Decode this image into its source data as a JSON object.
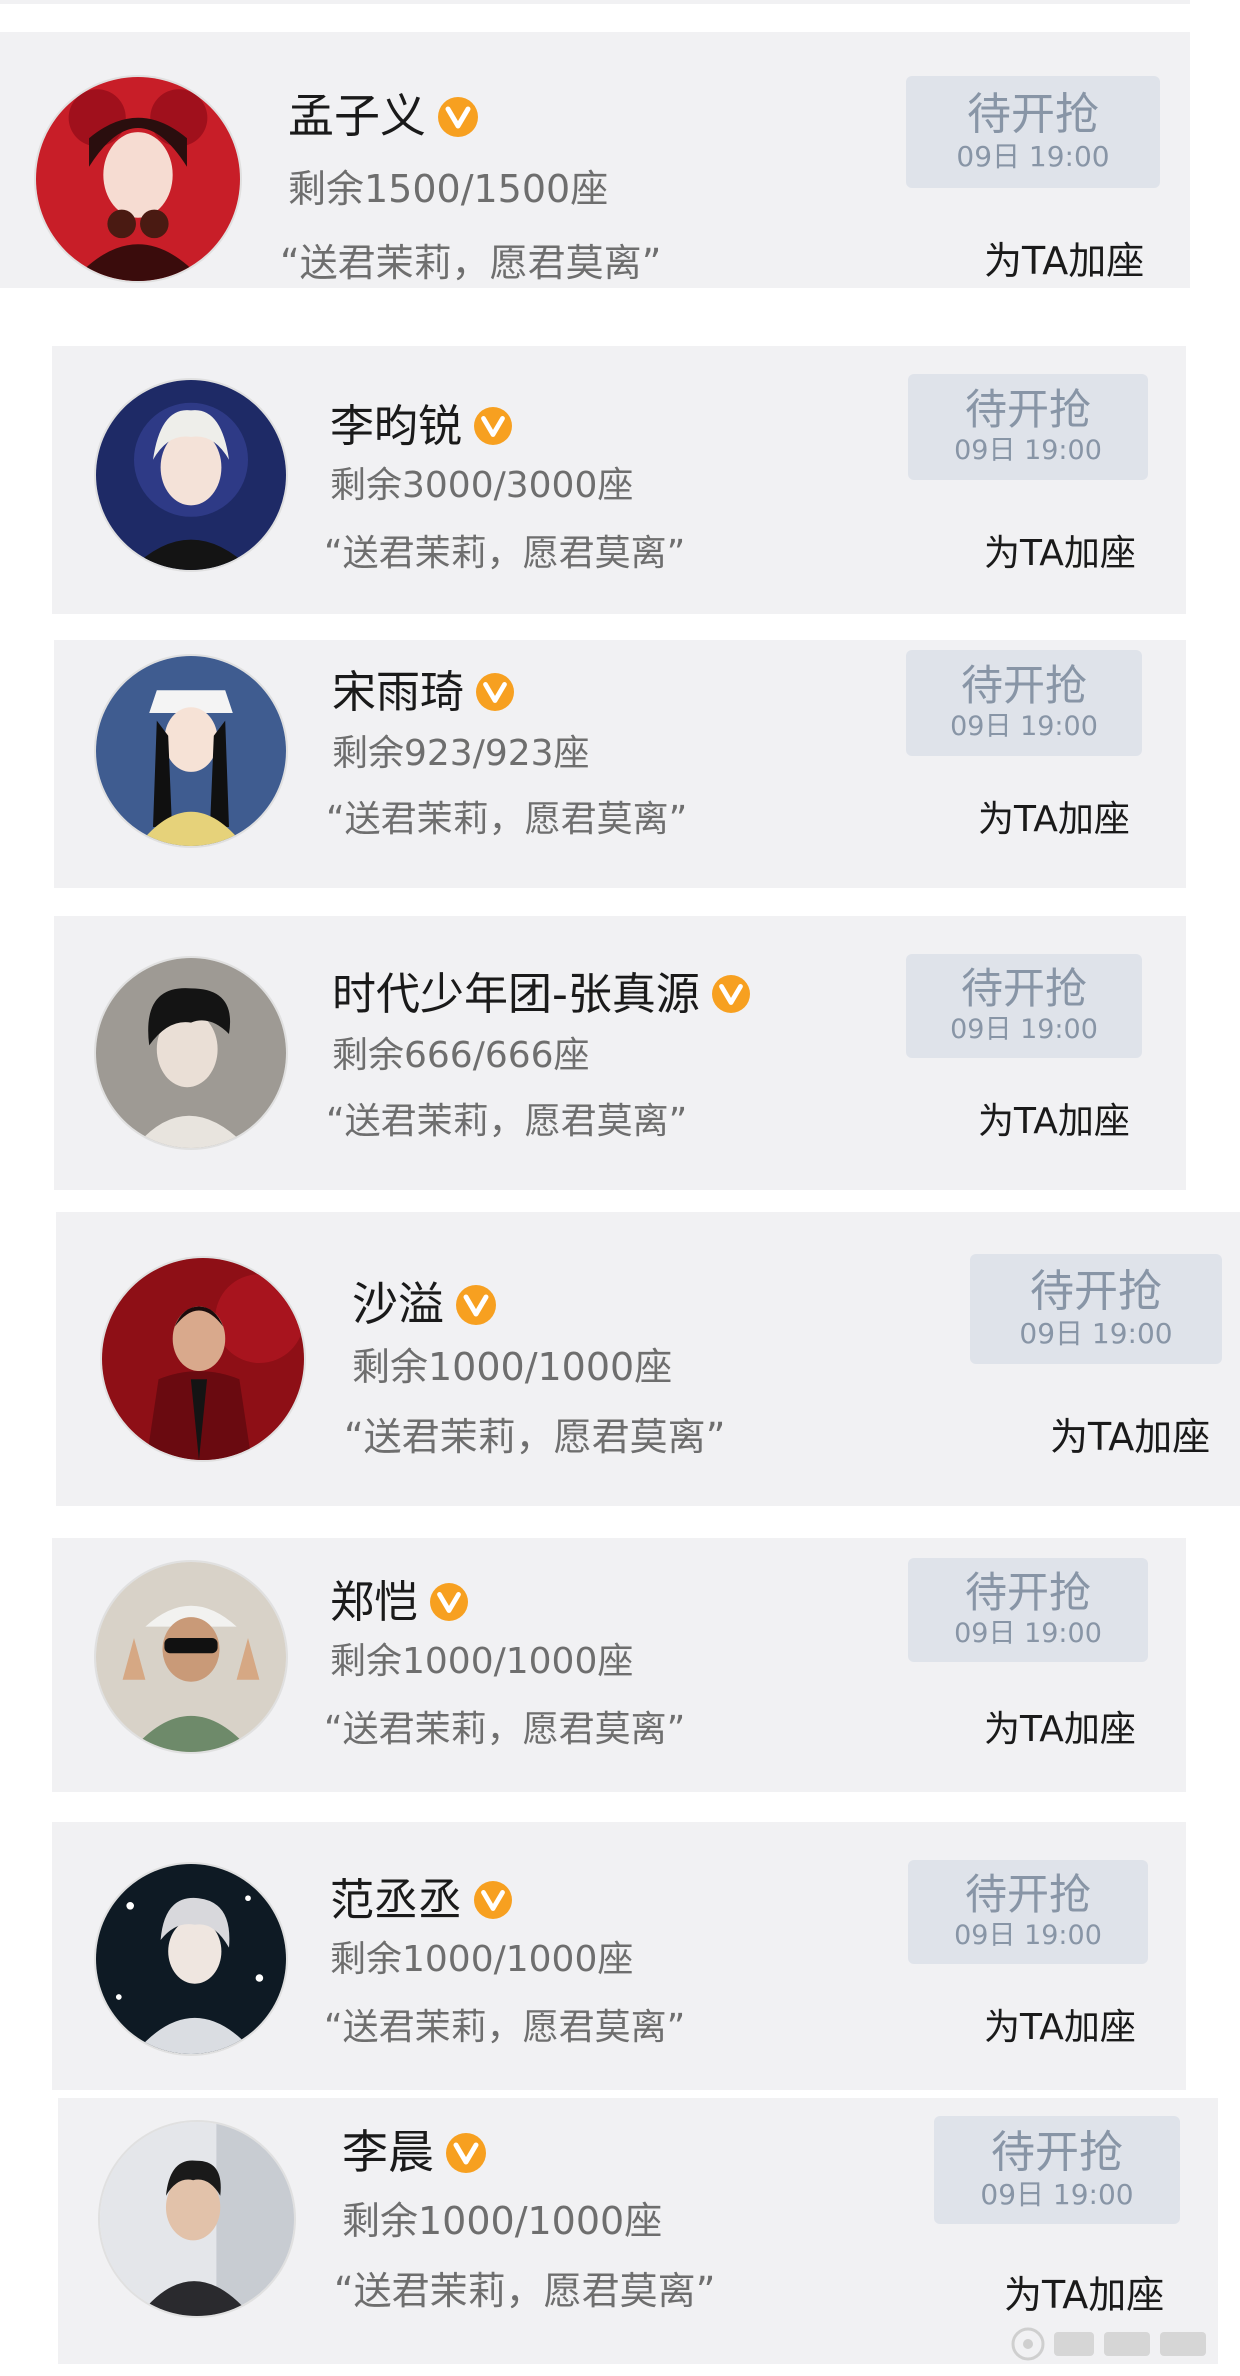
{
  "colors": {
    "card_bg": "#f1f1f3",
    "badge": "#f7a020",
    "button_bg": "#dfe3ea",
    "button_text": "#8895a6"
  },
  "cards": [
    {
      "name": "孟子义",
      "seats": "剩余1500/1500座",
      "quote": "“送君茉莉，愿君莫离”",
      "button_label": "待开抢",
      "button_time": "09日 19:00",
      "add_seat": "为TA加座",
      "verified_icon": "verified-v-icon"
    },
    {
      "name": "李昀锐",
      "seats": "剩余3000/3000座",
      "quote": "“送君茉莉，愿君莫离”",
      "button_label": "待开抢",
      "button_time": "09日 19:00",
      "add_seat": "为TA加座",
      "verified_icon": "verified-v-icon"
    },
    {
      "name": "宋雨琦",
      "seats": "剩余923/923座",
      "quote": "“送君茉莉，愿君莫离”",
      "button_label": "待开抢",
      "button_time": "09日 19:00",
      "add_seat": "为TA加座",
      "verified_icon": "verified-v-icon"
    },
    {
      "name": "时代少年团-张真源",
      "seats": "剩余666/666座",
      "quote": "“送君茉莉，愿君莫离”",
      "button_label": "待开抢",
      "button_time": "09日 19:00",
      "add_seat": "为TA加座",
      "verified_icon": "verified-v-icon"
    },
    {
      "name": "沙溢",
      "seats": "剩余1000/1000座",
      "quote": "“送君茉莉，愿君莫离”",
      "button_label": "待开抢",
      "button_time": "09日 19:00",
      "add_seat": "为TA加座",
      "verified_icon": "verified-v-icon"
    },
    {
      "name": "郑恺",
      "seats": "剩余1000/1000座",
      "quote": "“送君茉莉，愿君莫离”",
      "button_label": "待开抢",
      "button_time": "09日 19:00",
      "add_seat": "为TA加座",
      "verified_icon": "verified-v-icon"
    },
    {
      "name": "范丞丞",
      "seats": "剩余1000/1000座",
      "quote": "“送君茉莉，愿君莫离”",
      "button_label": "待开抢",
      "button_time": "09日 19:00",
      "add_seat": "为TA加座",
      "verified_icon": "verified-v-icon"
    },
    {
      "name": "李晨",
      "seats": "剩余1000/1000座",
      "quote": "“送君茉莉，愿君莫离”",
      "button_label": "待开抢",
      "button_time": "09日 19:00",
      "add_seat": "为TA加座",
      "verified_icon": "verified-v-icon"
    }
  ]
}
